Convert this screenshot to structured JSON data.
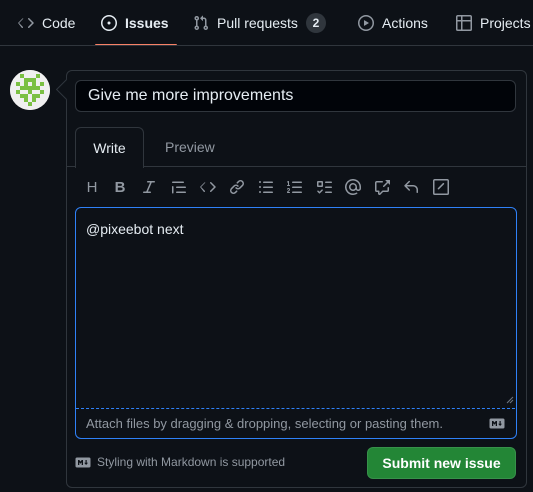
{
  "nav": {
    "tabs": [
      {
        "label": "Code",
        "icon": "code-icon"
      },
      {
        "label": "Issues",
        "icon": "issue-opened-icon",
        "selected": true
      },
      {
        "label": "Pull requests",
        "icon": "git-pull-request-icon",
        "count": "2"
      },
      {
        "label": "Actions",
        "icon": "play-icon"
      },
      {
        "label": "Projects",
        "icon": "table-icon"
      }
    ]
  },
  "issue_form": {
    "title_value": "Give me more improvements",
    "tabs": {
      "write": "Write",
      "preview": "Preview"
    },
    "toolbar": [
      "heading-icon",
      "bold-icon",
      "italic-icon",
      "quote-icon",
      "code-icon",
      "link-icon",
      "unordered-list-icon",
      "ordered-list-icon",
      "tasklist-icon",
      "mention-icon",
      "cross-reference-icon",
      "reply-icon",
      "slash-command-icon"
    ],
    "heading_glyph": "H",
    "bold_glyph": "B",
    "comment_text": "@pixeebot next",
    "attach_text": "Attach files by dragging & dropping, selecting or pasting them.",
    "markdown_note": "Styling with Markdown is supported",
    "submit_label": "Submit new issue"
  },
  "colors": {
    "background": "#0d1117",
    "accent_underline": "#f78166",
    "focus_border": "#2f81f7",
    "submit_button": "#238636",
    "muted_text": "#9198a1"
  }
}
